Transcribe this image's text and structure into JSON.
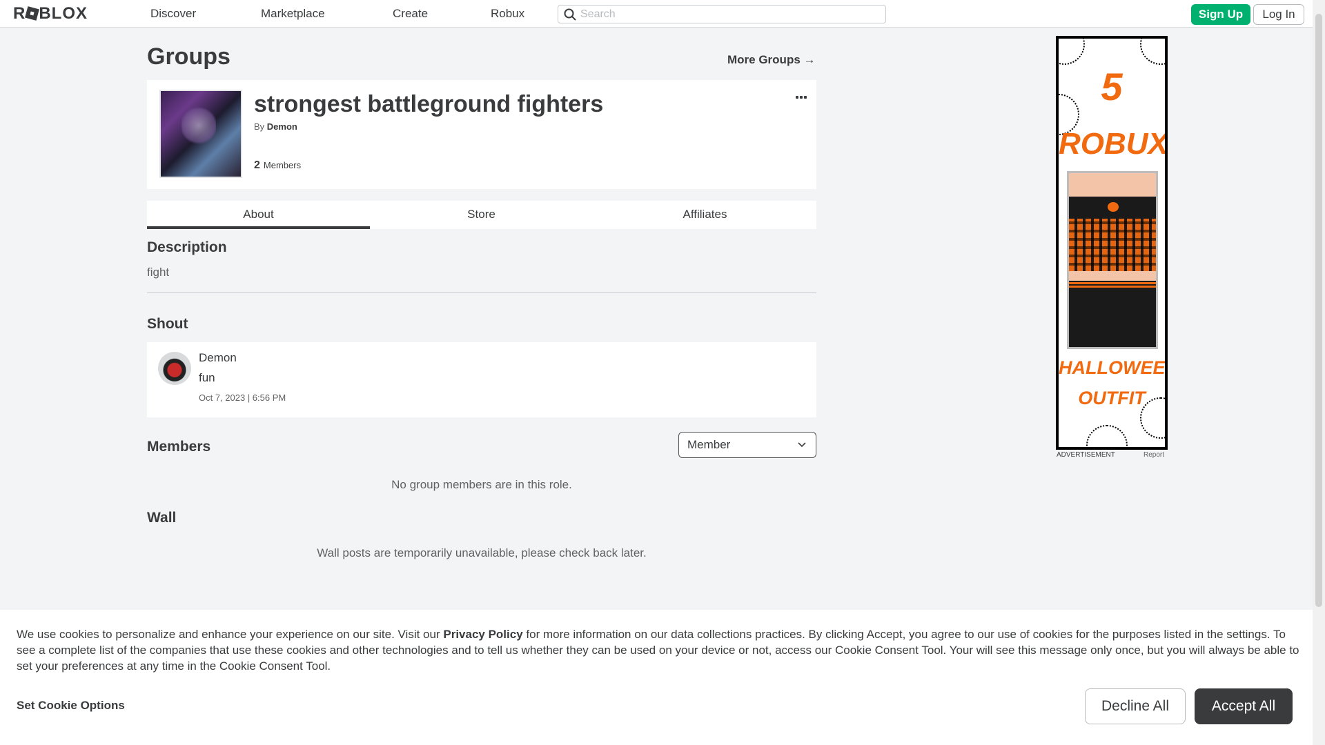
{
  "nav": {
    "logo": "ROBLOX",
    "links": [
      "Discover",
      "Marketplace",
      "Create",
      "Robux"
    ],
    "search_placeholder": "Search",
    "signup_label": "Sign Up",
    "login_label": "Log In"
  },
  "page": {
    "title": "Groups",
    "more_groups": "More Groups →"
  },
  "group": {
    "name": "strongest battleground fighters",
    "by_prefix": "By",
    "owner": "Demon",
    "member_count": "2",
    "members_label": "Members"
  },
  "tabs": [
    "About",
    "Store",
    "Affiliates"
  ],
  "about": {
    "description_heading": "Description",
    "description": "fight",
    "shout_heading": "Shout",
    "shout": {
      "user": "Demon",
      "message": "fun",
      "time": "Oct 7, 2023 | 6:56 PM"
    },
    "members_heading": "Members",
    "role_selected": "Member",
    "members_empty": "No group members are in this role.",
    "wall_heading": "Wall",
    "wall_empty": "Wall posts are temporarily unavailable, please check back later."
  },
  "ad": {
    "headline_number": "5",
    "headline_word": "ROBUX",
    "footer_line1": "HALLOWEEN",
    "footer_line2": "OUTFIT",
    "label": "ADVERTISEMENT",
    "report": "Report"
  },
  "cookie": {
    "text_before_link": "We use cookies to personalize and enhance your experience on our site. Visit our ",
    "link": "Privacy Policy",
    "text_after_link": " for more information on our data collections practices. By clicking Accept, you agree to our use of cookies for the purposes listed in the settings. To see a complete list of the companies that use these cookies and other technologies and to tell us whether they can be used on your device or not, access our Cookie Consent Tool. Your will see this message only once, but you will always be able to set your preferences at any time in the Cookie Consent Tool.",
    "options_label": "Set Cookie Options",
    "decline_label": "Decline All",
    "accept_label": "Accept All"
  },
  "colors": {
    "signup": "#00b06f",
    "accent_dark": "#393b3d",
    "ad_orange": "#f26a10"
  },
  "icons": [
    "search-icon",
    "arrow-right-icon",
    "more-options-icon",
    "chevron-down-icon"
  ]
}
